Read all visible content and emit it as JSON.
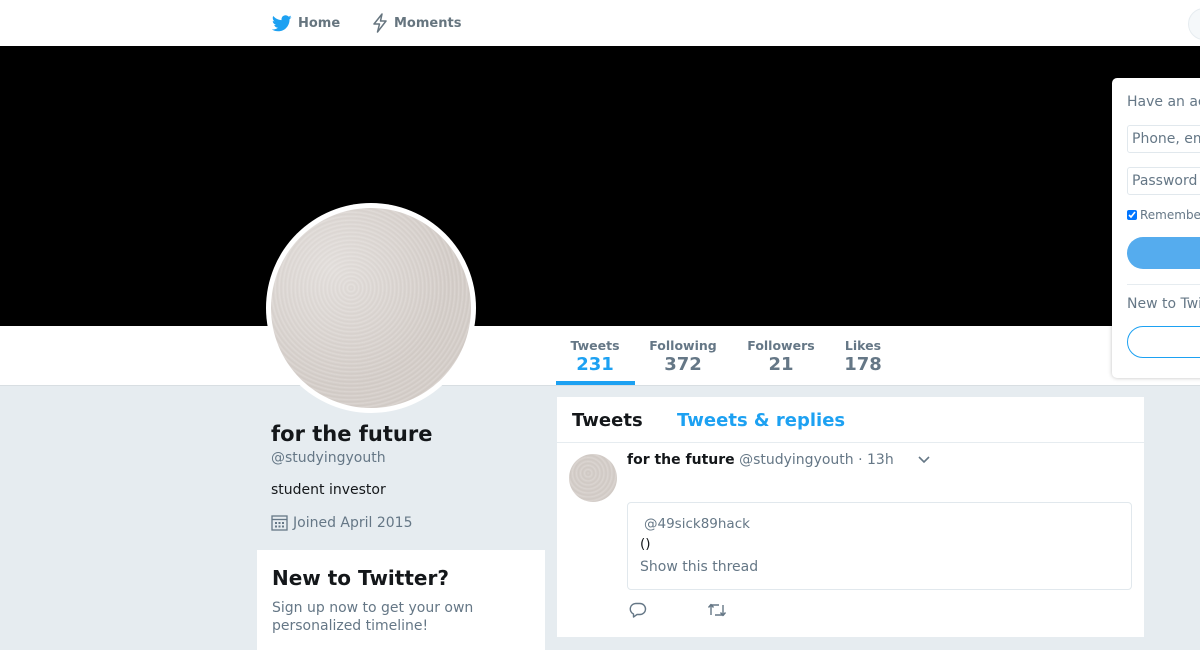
{
  "nav": {
    "home_label": "Home",
    "moments_label": "Moments",
    "brand_color": "#1da1f2"
  },
  "profile": {
    "name": "for the future",
    "handle": "@studyingyouth",
    "bio": "student investor",
    "joined": "Joined April 2015"
  },
  "stats": [
    {
      "label": "Tweets",
      "value": "231",
      "active": true
    },
    {
      "label": "Following",
      "value": "372"
    },
    {
      "label": "Followers",
      "value": "21"
    },
    {
      "label": "Likes",
      "value": "178"
    }
  ],
  "new_to_twitter": {
    "title": "New to Twitter?",
    "text": "Sign up now to get your own personalized timeline!"
  },
  "timeline": {
    "tabs": [
      {
        "label": "Tweets",
        "active": true
      },
      {
        "label": "Tweets & replies"
      }
    ],
    "tweet": {
      "name": "for the future",
      "handle": "@studyingyouth",
      "time": "· 13h",
      "quote_mention": "@49sick89hack",
      "quote_text": "()",
      "show_thread": "Show this thread"
    }
  },
  "login": {
    "title": "Have an account?",
    "username_placeholder": "Phone, email or username",
    "password_placeholder": "Password",
    "remember": "Remember me",
    "new_prompt": "New to Twitter?"
  }
}
